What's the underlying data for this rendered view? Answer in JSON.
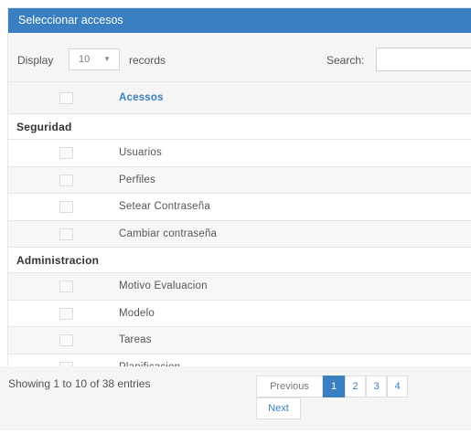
{
  "panel": {
    "title": "Seleccionar accesos"
  },
  "toolbar": {
    "display_label": "Display",
    "length_value": "10",
    "records_label": "records",
    "search_label": "Search:",
    "search_value": ""
  },
  "table": {
    "header": "Acessos",
    "groups": [
      {
        "name": "Seguridad",
        "items": [
          "Usuarios",
          "Perfiles",
          "Setear Contraseña",
          "Cambiar contraseña"
        ]
      },
      {
        "name": "Administracion",
        "items": [
          "Motivo Evaluacion",
          "Modelo",
          "Tareas",
          "Planificacion"
        ]
      }
    ]
  },
  "footer": {
    "info": "Showing 1 to 10 of 38 entries",
    "previous": "Previous",
    "next": "Next",
    "pages": [
      "1",
      "2",
      "3",
      "4"
    ],
    "active_page": "1"
  },
  "colors": {
    "accent": "#3a7fc1",
    "toolbar_bg": "#f5f5f5"
  },
  "icons": {
    "select_arrow": "chevron-down-icon"
  }
}
